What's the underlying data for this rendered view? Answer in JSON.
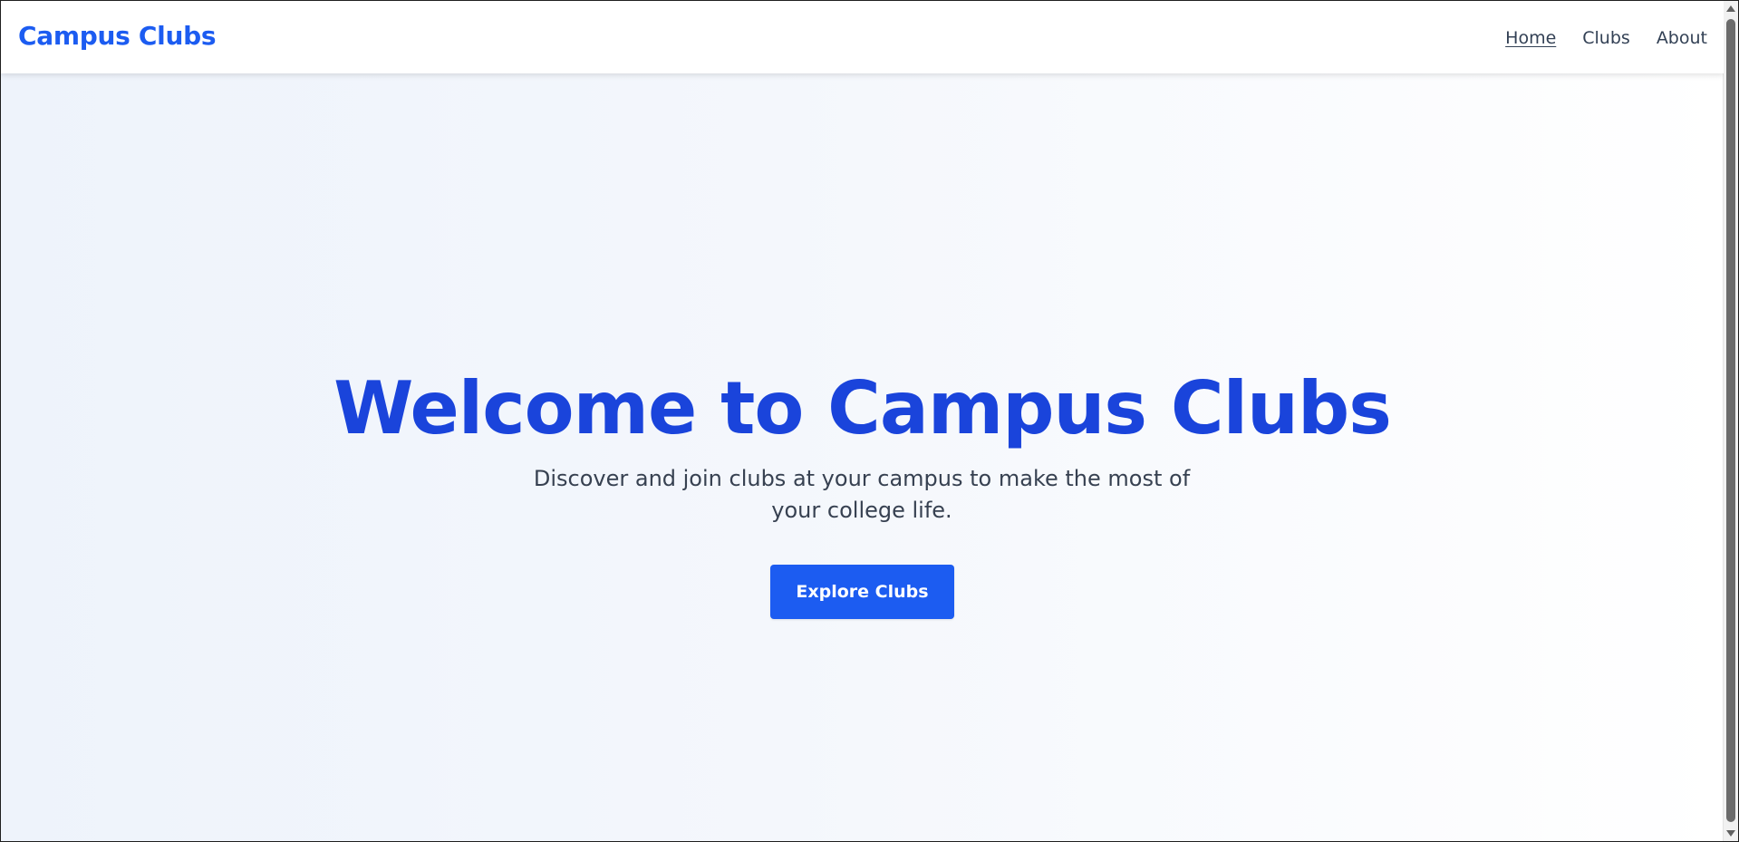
{
  "nav": {
    "brand": "Campus Clubs",
    "links": [
      {
        "label": "Home",
        "active": true
      },
      {
        "label": "Clubs",
        "active": false
      },
      {
        "label": "About",
        "active": false
      }
    ]
  },
  "hero": {
    "title": "Welcome to Campus Clubs",
    "subtitle": "Discover and join clubs at your campus to make the most of your college life.",
    "cta_label": "Explore Clubs"
  },
  "colors": {
    "brand": "#1c5cf1",
    "title": "#1a44db",
    "text": "#374151",
    "nav_text": "#334155"
  }
}
